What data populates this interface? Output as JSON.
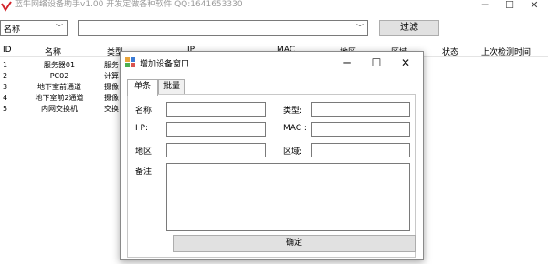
{
  "window": {
    "title": "蓝牛网络设备助手v1.00   开发定做各种软件 QQ:1641653330",
    "minimize_glyph": "─",
    "maximize_glyph": "☐",
    "close_glyph": "✕"
  },
  "filter": {
    "field_value": "名称",
    "text_value": "",
    "button_label": "过滤"
  },
  "grid": {
    "columns": [
      "ID",
      "名称",
      "类型",
      "IP",
      "MAC",
      "地区",
      "区域",
      "状态",
      "上次检测时间"
    ],
    "rows": [
      {
        "id": "1",
        "name": "服务器01",
        "type": "服务"
      },
      {
        "id": "2",
        "name": "PC02",
        "type": "计算"
      },
      {
        "id": "3",
        "name": "地下室前通道",
        "type": "摄像"
      },
      {
        "id": "4",
        "name": "地下室前2通道",
        "type": "摄像"
      },
      {
        "id": "5",
        "name": "内网交换机",
        "type": "交换"
      }
    ]
  },
  "dialog": {
    "title": "增加设备窗口",
    "minimize_glyph": "─",
    "maximize_glyph": "☐",
    "close_glyph": "✕",
    "tabs": [
      "单条",
      "批量"
    ],
    "fields": {
      "name_label": "名称:",
      "type_label": "类型:",
      "ip_label": "I P:",
      "mac_label": "MAC :",
      "region_label": "地区:",
      "area_label": "区域:",
      "note_label": "备注:"
    },
    "confirm_label": "确定"
  }
}
